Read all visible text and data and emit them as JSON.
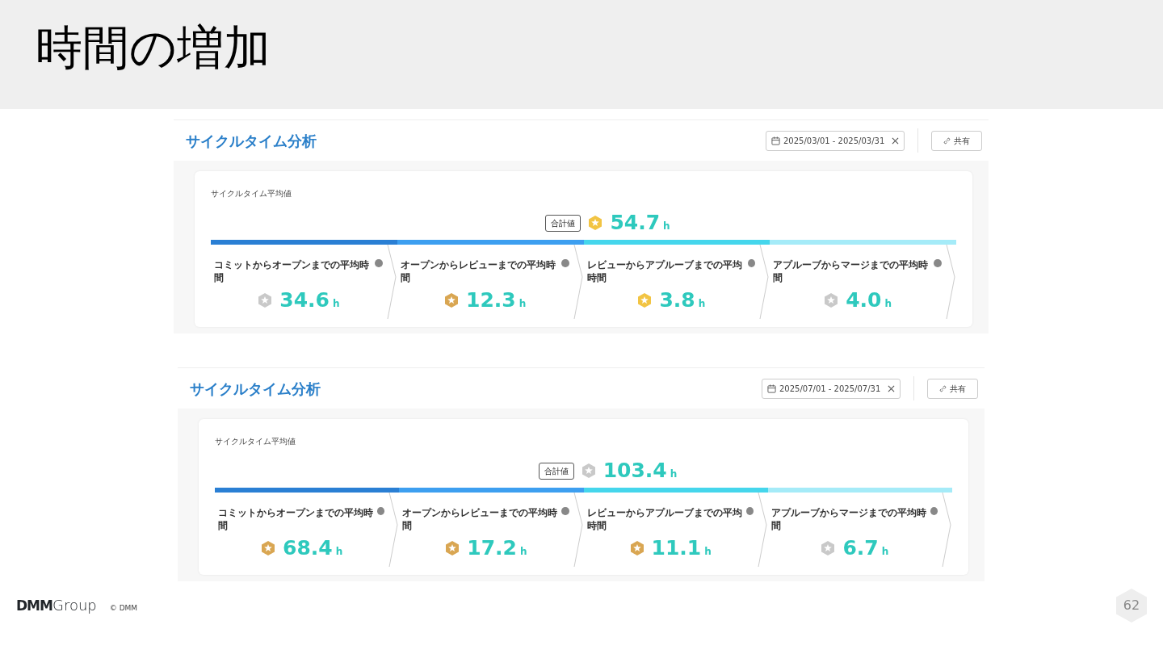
{
  "slide_title": "時間の増加",
  "panels": [
    {
      "title": "サイクルタイム分析",
      "date_range": "2025/03/01 - 2025/03/31",
      "share_button": "共有",
      "card_title": "サイクルタイム平均値",
      "total_label": "合計値",
      "total": {
        "value": "54.7",
        "unit": "h",
        "color": "#f2c443"
      },
      "stages": [
        {
          "label": "コミットからオープンまでの平均時間",
          "value": "34.6",
          "unit": "h",
          "color": "#c9c9c9",
          "bar": {
            "color": "#2a7fd4"
          }
        },
        {
          "label": "オープンからレビューまでの平均時間",
          "value": "12.3",
          "unit": "h",
          "color": "#d9a652",
          "bar": {
            "color": "#3d9ff0"
          }
        },
        {
          "label": "レビューからアプルーブまでの平均時間",
          "value": "3.8",
          "unit": "h",
          "color": "#f2c443",
          "bar": {
            "color": "#45d6ec"
          }
        },
        {
          "label": "アプルーブからマージまでの平均時間",
          "value": "4.0",
          "unit": "h",
          "color": "#c9c9c9",
          "bar": {
            "color": "#a5ebf8"
          }
        }
      ]
    },
    {
      "title": "サイクルタイム分析",
      "date_range": "2025/07/01 - 2025/07/31",
      "share_button": "共有",
      "card_title": "サイクルタイム平均値",
      "total_label": "合計値",
      "total": {
        "value": "103.4",
        "unit": "h",
        "color": "#c9c9c9"
      },
      "stages": [
        {
          "label": "コミットからオープンまでの平均時間",
          "value": "68.4",
          "unit": "h",
          "color": "#d9a652",
          "bar": {
            "color": "#2a7fd4"
          }
        },
        {
          "label": "オープンからレビューまでの平均時間",
          "value": "17.2",
          "unit": "h",
          "color": "#d9a652",
          "bar": {
            "color": "#3d9ff0"
          }
        },
        {
          "label": "レビューからアプルーブまでの平均時間",
          "value": "11.1",
          "unit": "h",
          "color": "#d9a652",
          "bar": {
            "color": "#45d6ec"
          }
        },
        {
          "label": "アプルーブからマージまでの平均時間",
          "value": "6.7",
          "unit": "h",
          "color": "#c9c9c9",
          "bar": {
            "color": "#a5ebf8"
          }
        }
      ]
    }
  ],
  "footer": {
    "logo_bold": "DMM",
    "logo_light": "Group",
    "copyright": "© DMM",
    "page_number": "62"
  }
}
